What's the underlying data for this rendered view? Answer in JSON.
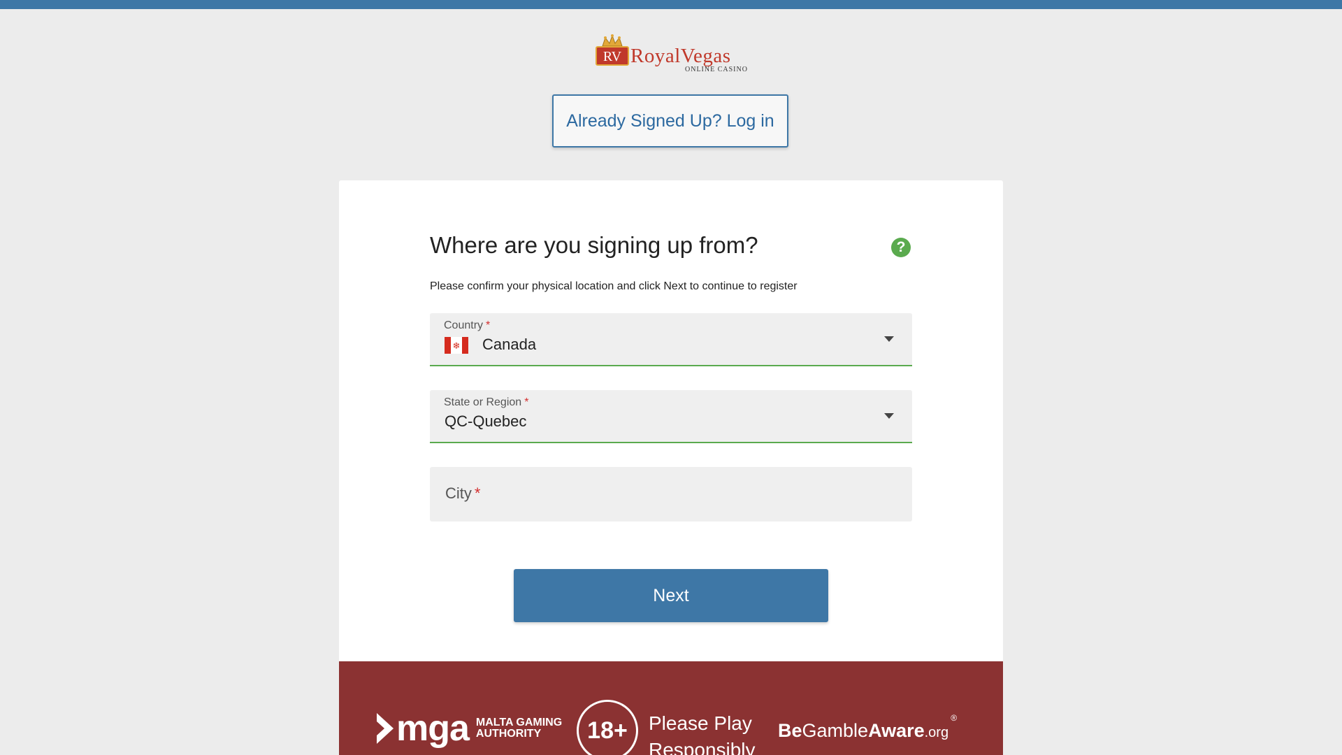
{
  "logo": {
    "brand_name": "RoyalVegas",
    "subtitle": "ONLINE CASINO",
    "monogram": "RV"
  },
  "login_button": {
    "label": "Already Signed Up? Log in"
  },
  "form": {
    "title": "Where are you signing up from?",
    "subtitle": "Please confirm your physical location and click Next to continue to register",
    "help_icon": "?",
    "country": {
      "label": "Country",
      "required_mark": "*",
      "value": "Canada",
      "icon": "canada-flag-icon"
    },
    "region": {
      "label": "State or Region",
      "required_mark": "*",
      "value": "QC-Quebec"
    },
    "city": {
      "label": "City",
      "required_mark": "*",
      "value": ""
    },
    "next_label": "Next"
  },
  "footer": {
    "mga_text": "mga",
    "mga_line1": "MALTA GAMING",
    "mga_line2": "AUTHORITY",
    "age_badge": "18+",
    "play_line1": "Please Play",
    "play_line2": "Responsibly",
    "bga_part1": "Be",
    "bga_part2": "Gamble",
    "bga_part3": "Aware",
    "bga_part4": ".org",
    "bga_reg": "®"
  },
  "colors": {
    "primary_blue": "#3e77a6",
    "success_green": "#5aaa4e",
    "required_red": "#d32f2f",
    "footer_red": "#8b3232",
    "background": "#ececec"
  }
}
